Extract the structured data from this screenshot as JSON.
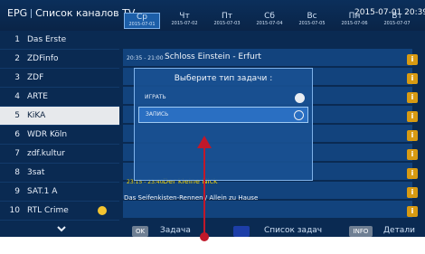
{
  "header": {
    "app_label": "EPG",
    "title": "Список каналов TV",
    "datetime": "2015-07-01 20:39:32"
  },
  "days": [
    {
      "day": "Ср",
      "date": "2015-07-01",
      "selected": true
    },
    {
      "day": "Чт",
      "date": "2015-07-02"
    },
    {
      "day": "Пт",
      "date": "2015-07-03"
    },
    {
      "day": "Сб",
      "date": "2015-07-04"
    },
    {
      "day": "Вс",
      "date": "2015-07-05"
    },
    {
      "day": "Пн",
      "date": "2015-07-06"
    },
    {
      "day": "Вт",
      "date": "2015-07-07"
    }
  ],
  "channels": [
    {
      "num": "1",
      "name": "Das Erste"
    },
    {
      "num": "2",
      "name": "ZDFinfo"
    },
    {
      "num": "3",
      "name": "ZDF"
    },
    {
      "num": "4",
      "name": "ARTE"
    },
    {
      "num": "5",
      "name": "KiKA",
      "selected": true
    },
    {
      "num": "6",
      "name": "WDR Köln"
    },
    {
      "num": "7",
      "name": "zdf.kultur"
    },
    {
      "num": "8",
      "name": "3sat"
    },
    {
      "num": "9",
      "name": "SAT.1 A"
    },
    {
      "num": "10",
      "name": "RTL Crime"
    }
  ],
  "programs": {
    "row1_time": "20:35 - 21:00",
    "row1_title": "Schloss Einstein - Erfurt",
    "row8_time": "23:15 - 23:40",
    "row8_title": "Der kleine Nick",
    "row9_title": "Das Seifenkisten-Rennen / Allein zu Hause"
  },
  "dialog": {
    "title": "Выберите тип задачи :",
    "options": [
      {
        "label": "ИГРАТЬ",
        "selected": false
      },
      {
        "label": "ЗАПИСЬ",
        "selected": true
      }
    ]
  },
  "footer": {
    "ok_key": "OK",
    "ok_label": "Задача",
    "blue_label": "Список задач",
    "info_key": "INFO",
    "info_label": "Детали"
  },
  "info_badge": "i",
  "colors": {
    "background": "#0a2a52",
    "accent": "#1c5ea8",
    "annotation": "#c0182a",
    "info_badge": "#d79a12",
    "favorite_dot": "#f4c430"
  }
}
